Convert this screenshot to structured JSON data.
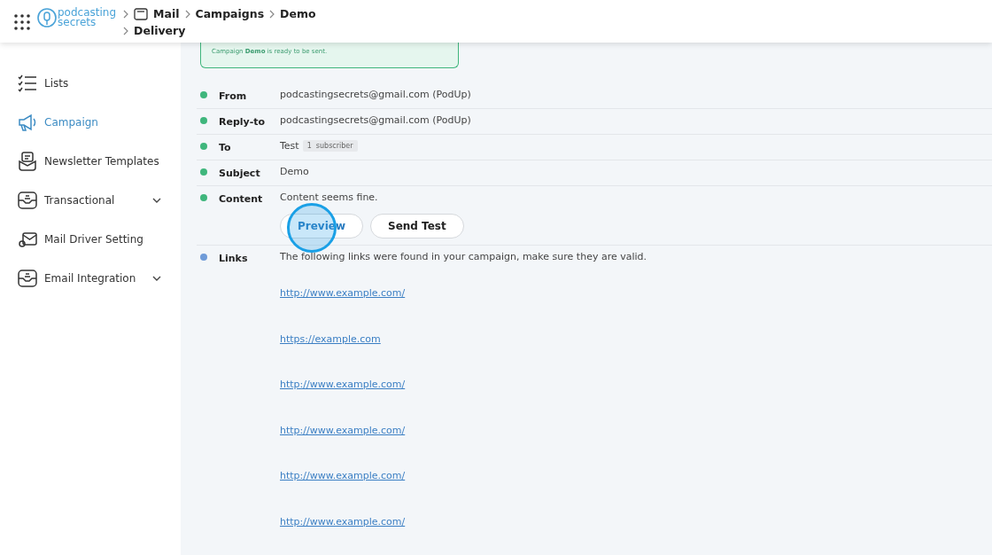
{
  "header": {
    "logo_line1": "podcasting",
    "logo_line2": "secrets",
    "breadcrumbs": [
      "Mail",
      "Campaigns",
      "Demo",
      "Delivery"
    ]
  },
  "sidebar": {
    "items": [
      {
        "label": "Lists",
        "kind": "lists",
        "selected": false,
        "expandable": false
      },
      {
        "label": "Campaign",
        "kind": "campaign",
        "selected": true,
        "expandable": false
      },
      {
        "label": "Newsletter Templates",
        "kind": "template",
        "selected": false,
        "expandable": false
      },
      {
        "label": "Transactional",
        "kind": "tray",
        "selected": false,
        "expandable": true
      },
      {
        "label": "Mail Driver Setting",
        "kind": "driver",
        "selected": false,
        "expandable": false
      },
      {
        "label": "Email Integration",
        "kind": "tray",
        "selected": false,
        "expandable": true
      }
    ]
  },
  "alert": {
    "text": "Campaign **Demo** is ready to be sent."
  },
  "checks": [
    {
      "label": "From",
      "value": "podcastingsecrets@gmail.com (PodUp)",
      "color": "#3fb67c"
    },
    {
      "label": "Reply-to",
      "value": "podcastingsecrets@gmail.com (PodUp)",
      "color": "#3fb67c"
    },
    {
      "label": "To",
      "value": "Test",
      "badge_count": "1",
      "badge_label": "subscriber",
      "color": "#3fb67c"
    },
    {
      "label": "Subject",
      "value": "Demo",
      "color": "#3fb67c"
    },
    {
      "label": "Content",
      "value": "Content seems fine.",
      "color": "#3fb67c",
      "buttons": [
        "Preview",
        "Send Test"
      ]
    },
    {
      "label": "Links",
      "value": "The following links were found in your campaign, make sure they are valid.",
      "color": "#6f9bd8",
      "links": [
        "http://www.example.com/",
        "https://example.com",
        "http://www.example.com/",
        "http://www.example.com/",
        "http://www.example.com/",
        "http://www.example.com/"
      ]
    }
  ]
}
